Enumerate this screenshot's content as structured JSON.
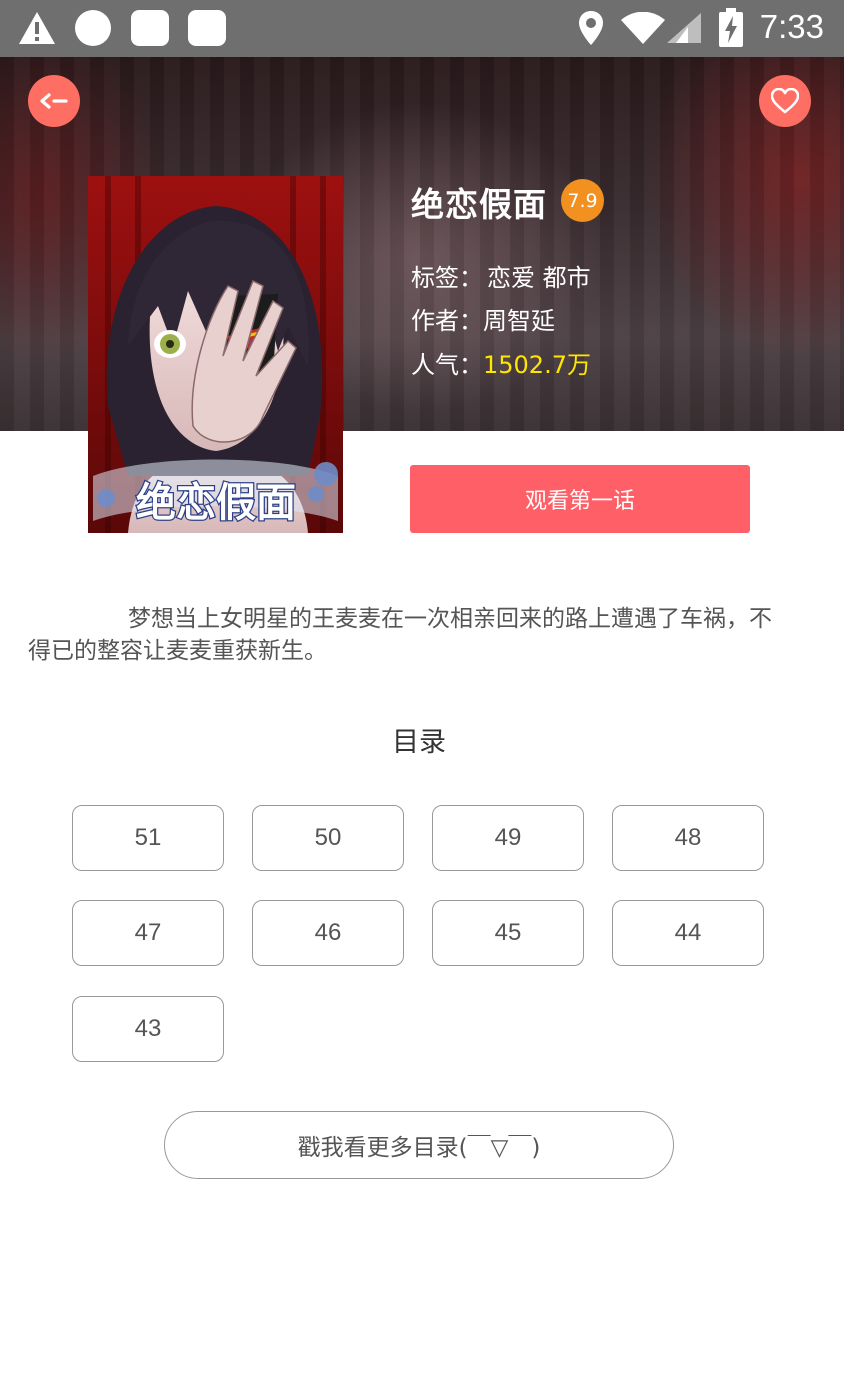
{
  "status_bar": {
    "time": "7:33",
    "icons": [
      "warning-icon",
      "circle-notification-icon",
      "square-notification-icon",
      "square-notification-icon",
      "location-icon",
      "wifi-icon",
      "signal-icon",
      "battery-charging-icon"
    ]
  },
  "header": {
    "back_icon": "back-arrow-icon",
    "favorite_icon": "heart-icon"
  },
  "comic": {
    "title": "绝恋假面",
    "score": "7.9",
    "tags_label": "标签：",
    "tags": "恋爱 都市",
    "author_label": "作者：",
    "author": "周智延",
    "popularity_label": "人气：",
    "popularity": "1502.7万",
    "cover_logo_text": "绝恋假面"
  },
  "watch_button": "观看第一话",
  "description": "梦想当上女明星的王麦麦在一次相亲回来的路上遭遇了车祸，不得已的整容让麦麦重获新生。",
  "toc": {
    "title": "目录",
    "chapters": [
      "51",
      "50",
      "49",
      "48",
      "47",
      "46",
      "45",
      "44",
      "43"
    ],
    "more_label": "戳我看更多目录(￣▽￣)"
  },
  "colors": {
    "accent": "#ff5f67",
    "round_button": "#ff6e63",
    "score_badge": "#f29020",
    "popularity": "#ffe600",
    "status_bar": "#6f6f6f"
  }
}
